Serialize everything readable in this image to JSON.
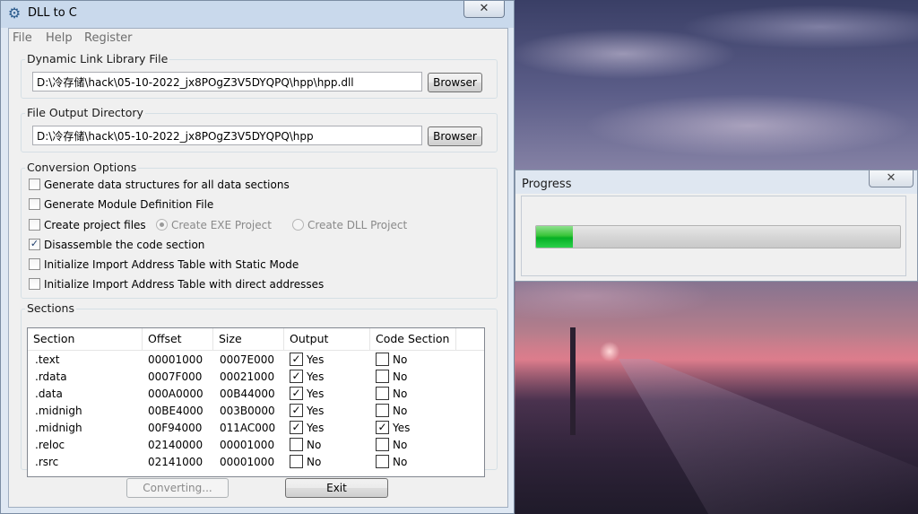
{
  "main_window": {
    "title": "DLL to C",
    "close_glyph": "✕",
    "menu": [
      "File",
      "Help",
      "Register"
    ],
    "dll_group": {
      "label": "Dynamic Link Library File",
      "path": "D:\\冷存储\\hack\\05-10-2022_jx8POgZ3V5DYQPQ\\hpp\\hpp.dll",
      "browse_label": "Browser"
    },
    "output_group": {
      "label": "File Output Directory",
      "path": "D:\\冷存储\\hack\\05-10-2022_jx8POgZ3V5DYQPQ\\hpp",
      "browse_label": "Browser"
    },
    "options_group": {
      "label": "Conversion Options",
      "options": [
        {
          "label": "Generate data structures for all data sections",
          "checked": false
        },
        {
          "label": "Generate Module Definition File",
          "checked": false
        },
        {
          "label": "Create project files",
          "checked": false
        },
        {
          "label": "Disassemble the code section",
          "checked": true
        },
        {
          "label": "Initialize Import Address Table with Static Mode",
          "checked": false
        },
        {
          "label": "Initialize Import Address Table with direct addresses",
          "checked": false
        }
      ],
      "radio_exe": "Create EXE Project",
      "radio_dll": "Create DLL Project"
    },
    "sections_group": {
      "label": "Sections",
      "columns": [
        "Section",
        "Offset",
        "Size",
        "Output",
        "Code Section"
      ],
      "rows": [
        {
          "section": ".text",
          "offset": "00001000",
          "size": "0007E000",
          "output": "Yes",
          "output_checked": true,
          "code": "No",
          "code_checked": false
        },
        {
          "section": ".rdata",
          "offset": "0007F000",
          "size": "00021000",
          "output": "Yes",
          "output_checked": true,
          "code": "No",
          "code_checked": false
        },
        {
          "section": ".data",
          "offset": "000A0000",
          "size": "00B44000",
          "output": "Yes",
          "output_checked": true,
          "code": "No",
          "code_checked": false
        },
        {
          "section": ".midnigh",
          "offset": "00BE4000",
          "size": "003B0000",
          "output": "Yes",
          "output_checked": true,
          "code": "No",
          "code_checked": false
        },
        {
          "section": ".midnigh",
          "offset": "00F94000",
          "size": "011AC000",
          "output": "Yes",
          "output_checked": true,
          "code": "Yes",
          "code_checked": true
        },
        {
          "section": ".reloc",
          "offset": "02140000",
          "size": "00001000",
          "output": "No",
          "output_checked": false,
          "code": "No",
          "code_checked": false
        },
        {
          "section": ".rsrc",
          "offset": "02141000",
          "size": "00001000",
          "output": "No",
          "output_checked": false,
          "code": "No",
          "code_checked": false
        }
      ]
    },
    "converting_label": "Converting...",
    "exit_label": "Exit"
  },
  "progress_window": {
    "title": "Progress",
    "close_glyph": "✕",
    "progress_fraction": 0.1
  },
  "icons": {
    "app": "gear-icon",
    "check": "✓"
  }
}
